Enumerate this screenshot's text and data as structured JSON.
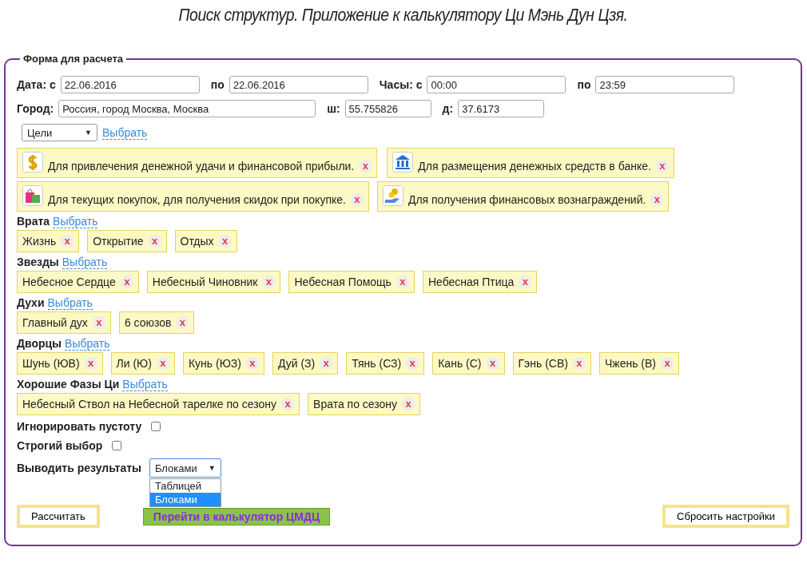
{
  "title": "Поиск структур. Приложение к калькулятору Ци Мэнь Дун Цзя.",
  "form": {
    "legend": "Форма для расчета",
    "rows": [
      [
        {
          "label": "Дата: с",
          "value": "22.06.2016"
        },
        {
          "label": "по",
          "value": "22.06.2016"
        },
        {
          "label": "Часы: с",
          "value": "00:00"
        },
        {
          "label": "по",
          "value": "23:59"
        }
      ],
      [
        {
          "label": "Город:",
          "value": "Россия, город Москва, Москва"
        },
        {
          "label": "ш:",
          "value": "55.755826"
        },
        {
          "label": "д:",
          "value": "37.6173"
        }
      ]
    ],
    "goals": {
      "select": "Цели",
      "link": "Выбрать",
      "rows": [
        [
          {
            "kind": "dollar",
            "text": "Для привлечения денежной удачи и финансовой прибыли.",
            "remove": "x"
          },
          {
            "kind": "bank",
            "text": "Для размещения денежных средств в банке.",
            "remove": "x"
          }
        ],
        [
          {
            "kind": "shopping",
            "text": "Для текущих покупок, для получения скидок при покупке.",
            "remove": "x"
          },
          {
            "kind": "reward",
            "text": "Для получения финансовых вознаграждений.",
            "remove": "x"
          }
        ]
      ]
    },
    "sections": [
      {
        "title": "Врата",
        "link": "Выбрать",
        "items": [
          {
            "text": "Жизнь",
            "remove": "x"
          },
          {
            "text": "Открытие",
            "remove": "x"
          },
          {
            "text": "Отдых",
            "remove": "x"
          }
        ]
      },
      {
        "title": "Звезды",
        "link": "Выбрать",
        "items": [
          {
            "text": "Небесное Сердце",
            "remove": "x"
          },
          {
            "text": "Небесный Чиновник",
            "remove": "x"
          },
          {
            "text": "Небесная Помощь",
            "remove": "x"
          },
          {
            "text": "Небесная Птица",
            "remove": "x"
          }
        ]
      },
      {
        "title": "Духи",
        "link": "Выбрать",
        "items": [
          {
            "text": "Главный дух",
            "remove": "x"
          },
          {
            "text": "6 союзов",
            "remove": "x"
          }
        ]
      },
      {
        "title": "Дворцы",
        "link": "Выбрать",
        "items": [
          {
            "text": "Шунь (ЮВ)",
            "remove": "x"
          },
          {
            "text": "Ли (Ю)",
            "remove": "x"
          },
          {
            "text": "Кунь (ЮЗ)",
            "remove": "x"
          },
          {
            "text": "Дуй (З)",
            "remove": "x"
          },
          {
            "text": "Тянь (СЗ)",
            "remove": "x"
          },
          {
            "text": "Кань (С)",
            "remove": "x"
          },
          {
            "text": "Гэнь (СВ)",
            "remove": "x"
          },
          {
            "text": "Чжень (В)",
            "remove": "x"
          }
        ]
      },
      {
        "title": "Хорошие Фазы Ци",
        "link": "Выбрать",
        "items": [
          {
            "text": "Небесный Ствол на Небесной тарелке по сезону",
            "remove": "x"
          },
          {
            "text": "Врата по сезону",
            "remove": "x"
          }
        ]
      }
    ],
    "checkboxes": [
      {
        "label": "Игнорировать пустоту",
        "checked": false
      },
      {
        "label": "Строгий выбор",
        "checked": false
      }
    ],
    "output": {
      "label": "Выводить результаты",
      "value": "Блоками",
      "arrow": "▼",
      "options": [
        {
          "text": "Таблицей",
          "selected": false
        },
        {
          "text": "Блоками",
          "selected": true
        }
      ]
    },
    "buttons": {
      "calculate": "Рассчитать",
      "go": "Перейти в калькулятор ЦМДЦ",
      "reset": "Сбросить настройки"
    }
  }
}
